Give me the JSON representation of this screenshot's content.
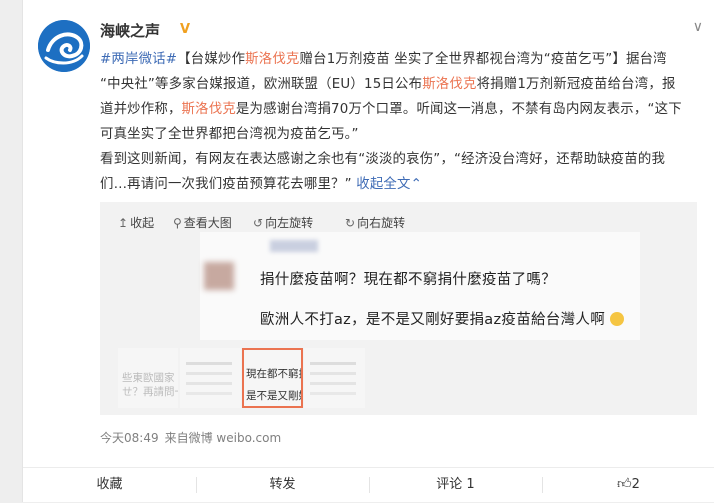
{
  "account": {
    "name": "海峡之声",
    "verified_mark": "V"
  },
  "post": {
    "hashtag": "#两岸微话#",
    "line1_a": "【台媒炒作",
    "mention1": "斯洛伐克",
    "line1_b": "赠台1万剂疫苗 坐实了全世界都视台湾为“疫苗乞丐”】据台湾",
    "line2_a": "“中央社”等多家台媒报道，欧洲联盟（EU）15日公布",
    "mention2": "斯洛伐克",
    "line2_b": "将捐赠1万剂新冠疫苗给台湾，报",
    "line3_a": "道并炒作称，",
    "mention3": "斯洛伐克",
    "line3_b": "是为感谢台湾捐70万个口罩。听闻这一消息，不禁有岛内网友表示，“这下",
    "line4": "可真坐实了全世界都把台湾视为疫苗乞丐。”",
    "line5": "看到这则新闻，有网友在表达感谢之余也有“淡淡的哀伤”，“经济没台湾好，还帮助缺疫苗的我",
    "line6": "们…再请问一次我们疫苗预算花去哪里？”",
    "collapse_label": "收起全文",
    "collapse_icon": "up-arrow-icon"
  },
  "image_toolbar": {
    "collapse": "收起",
    "view_large": "查看大图",
    "rotate_left": "向左旋转",
    "rotate_right": "向右旋转"
  },
  "image": {
    "comment1": "捐什麼疫苗啊？現在都不窮捐什麼疫苗了嗎？",
    "comment2": "歐洲人不打az，是不是又剛好要捐az疫苗給台灣人啊",
    "emoji": "awkward-face-emoji"
  },
  "thumbnails": [
    {
      "text_a": "些東歐國家",
      "text_b": "ㄝ？再請問一"
    },
    {
      "text_a": "",
      "text_b": ""
    },
    {
      "text_a": "現在都不窮捐什",
      "text_b": "是不是又剛好要"
    },
    {
      "text_a": "",
      "text_b": ""
    }
  ],
  "meta": {
    "time": "今天08:49",
    "source_prefix": "来自",
    "source": "微博 weibo.com"
  },
  "actions": {
    "favorite": "收藏",
    "repost": "转发",
    "comment": "评论 1",
    "like_count": "2"
  },
  "colors": {
    "link": "#eb7350",
    "topic": "#3e6bb5",
    "brand": "#1d6fc2"
  }
}
